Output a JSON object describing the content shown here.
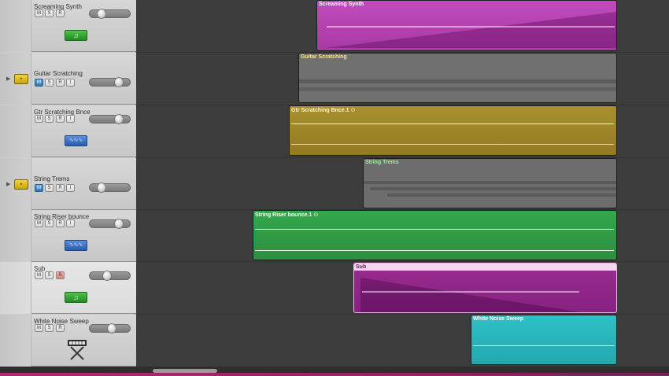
{
  "tracks": [
    {
      "name": "Screaming Synth",
      "buttons": [
        "M",
        "S",
        "R"
      ],
      "icon": "music-note-icon"
    },
    {
      "name": "Guitar Scratching",
      "buttons": [
        "M",
        "S",
        "R",
        "I"
      ],
      "icon": "audio-lane-icon"
    },
    {
      "name": "Gtr Scratching Bnce",
      "buttons": [
        "M",
        "S",
        "R",
        "I"
      ],
      "icon": "waveform-icon"
    },
    {
      "name": "String Trems",
      "buttons": [
        "M",
        "S",
        "R",
        "I"
      ],
      "icon": "audio-lane-icon"
    },
    {
      "name": "String Riser bounce",
      "buttons": [
        "M",
        "S",
        "R",
        "I"
      ],
      "icon": "waveform-icon"
    },
    {
      "name": "Sub",
      "buttons": [
        "M",
        "S",
        "R"
      ],
      "icon": "music-note-icon"
    },
    {
      "name": "White Noise Sweep",
      "buttons": [
        "M",
        "S",
        "R"
      ],
      "icon": "keyboard-stand-icon"
    }
  ],
  "regions": [
    {
      "title": "Screaming Synth",
      "color": "#b43fb0"
    },
    {
      "title": "Guitar Scratching",
      "color": "#6e6e6e"
    },
    {
      "title": "Gtr Scratching Bnce.1",
      "color": "#9f8a30",
      "loop_icon": "⊙"
    },
    {
      "title": "String Trems",
      "color": "#6b6b6b"
    },
    {
      "title": "String Riser bounce.1",
      "color": "#2f9a45",
      "loop_icon": "⊙"
    },
    {
      "title": "Sub",
      "color": "#992a8e"
    },
    {
      "title": "White Noise Sweep",
      "color": "#27b2b8"
    }
  ],
  "colors": {
    "mute_on": "#2f78b5",
    "header_bg": "#cfcfcf",
    "timeline_bg": "#3c3c3c",
    "bottom_accent": "#b02a78"
  }
}
